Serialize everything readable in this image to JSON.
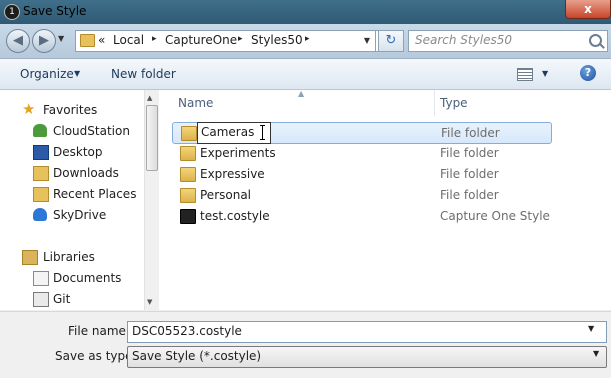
{
  "window": {
    "title": "Save Style",
    "close_label": "x"
  },
  "address": {
    "back_glyph": "◀",
    "forward_glyph": "▶",
    "overflow": "«",
    "crumbs": [
      "Local",
      "CaptureOne",
      "Styles50"
    ],
    "separator": "▸",
    "search_placeholder": "Search Styles50"
  },
  "toolbar": {
    "organize": "Organize",
    "new_folder": "New folder",
    "help": "?"
  },
  "nav": {
    "favorites_label": "Favorites",
    "favorites": [
      "CloudStation",
      "Desktop",
      "Downloads",
      "Recent Places",
      "SkyDrive"
    ],
    "libraries_label": "Libraries",
    "libraries": [
      "Documents",
      "Git"
    ]
  },
  "list": {
    "col_name": "Name",
    "col_type": "Type",
    "rows": [
      {
        "name": "Cameras",
        "type": "File folder",
        "icon": "folder-icon",
        "editing": true
      },
      {
        "name": "Experiments",
        "type": "File folder",
        "icon": "folder-icon"
      },
      {
        "name": "Expressive",
        "type": "File folder",
        "icon": "folder-icon"
      },
      {
        "name": "Personal",
        "type": "File folder",
        "icon": "folder-icon"
      },
      {
        "name": "test.costyle",
        "type": "Capture One Style",
        "icon": "style-file-icon"
      }
    ]
  },
  "form": {
    "file_name_label": "File name:",
    "file_name_value": "DSC05523.costyle",
    "save_type_label": "Save as type:",
    "save_type_value": "Save Style (*.costyle)"
  },
  "colors": {
    "accent": "#2f6db5",
    "selection": "#d6e8fb",
    "selection_border": "#84acdd"
  }
}
